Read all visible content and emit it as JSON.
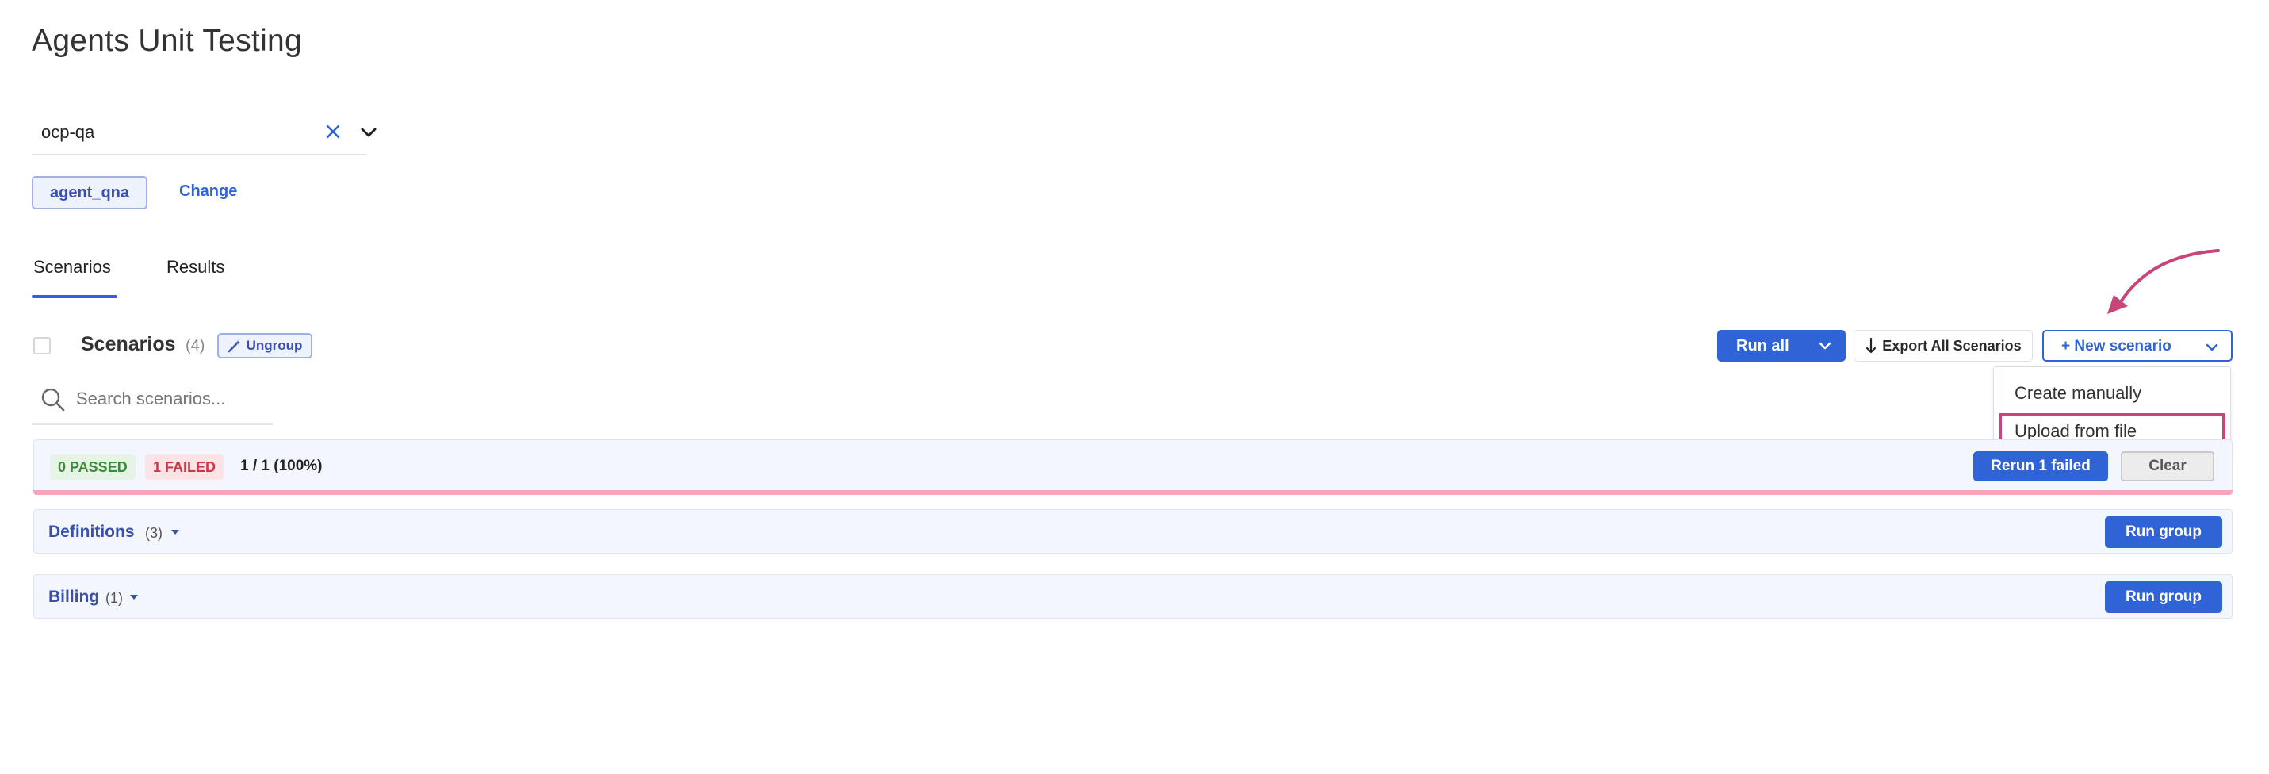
{
  "page": {
    "title": "Agents Unit Testing"
  },
  "project_select": {
    "value": "ocp-qa"
  },
  "agent": {
    "chip": "agent_qna",
    "change": "Change"
  },
  "tabs": [
    {
      "label": "Scenarios",
      "active": true
    },
    {
      "label": "Results",
      "active": false
    }
  ],
  "scenarios": {
    "title": "Scenarios",
    "count": "(4)",
    "ungroup": "Ungroup",
    "search_placeholder": "Search scenarios..."
  },
  "toolbar": {
    "run_all": "Run all",
    "export": "Export All Scenarios",
    "new_scenario": "+ New scenario"
  },
  "new_scenario_menu": {
    "items": [
      "Create manually",
      "Upload from file"
    ],
    "highlighted": "Upload from file"
  },
  "results_summary": {
    "passed": "0 PASSED",
    "failed": "1 FAILED",
    "progress": "1 / 1 (100%)",
    "rerun": "Rerun 1 failed",
    "clear": "Clear"
  },
  "groups": [
    {
      "name": "Definitions",
      "count": "(3)",
      "action": "Run group"
    },
    {
      "name": "Billing",
      "count": "(1)",
      "action": "Run group"
    }
  ],
  "colors": {
    "primary": "#2f63d6",
    "annotation": "#c8457a",
    "pass": "#3c8a3c",
    "fail": "#c83a4a",
    "group_text": "#3a4fb0"
  }
}
